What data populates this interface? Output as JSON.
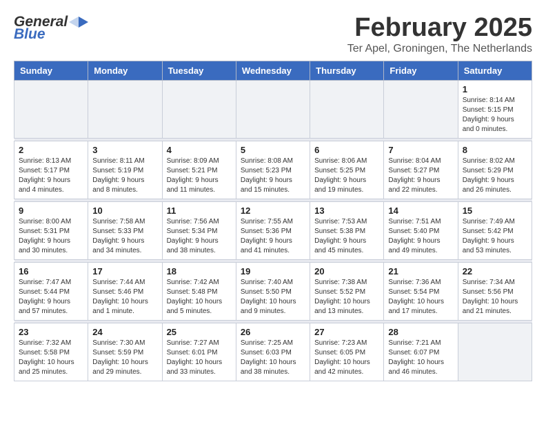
{
  "header": {
    "logo_general": "General",
    "logo_blue": "Blue",
    "month_title": "February 2025",
    "subtitle": "Ter Apel, Groningen, The Netherlands"
  },
  "weekdays": [
    "Sunday",
    "Monday",
    "Tuesday",
    "Wednesday",
    "Thursday",
    "Friday",
    "Saturday"
  ],
  "weeks": [
    [
      {
        "day": "",
        "empty": true
      },
      {
        "day": "",
        "empty": true
      },
      {
        "day": "",
        "empty": true
      },
      {
        "day": "",
        "empty": true
      },
      {
        "day": "",
        "empty": true
      },
      {
        "day": "",
        "empty": true
      },
      {
        "day": "1",
        "info": "Sunrise: 8:14 AM\nSunset: 5:15 PM\nDaylight: 9 hours and 0 minutes."
      }
    ],
    [
      {
        "day": "2",
        "info": "Sunrise: 8:13 AM\nSunset: 5:17 PM\nDaylight: 9 hours and 4 minutes."
      },
      {
        "day": "3",
        "info": "Sunrise: 8:11 AM\nSunset: 5:19 PM\nDaylight: 9 hours and 8 minutes."
      },
      {
        "day": "4",
        "info": "Sunrise: 8:09 AM\nSunset: 5:21 PM\nDaylight: 9 hours and 11 minutes."
      },
      {
        "day": "5",
        "info": "Sunrise: 8:08 AM\nSunset: 5:23 PM\nDaylight: 9 hours and 15 minutes."
      },
      {
        "day": "6",
        "info": "Sunrise: 8:06 AM\nSunset: 5:25 PM\nDaylight: 9 hours and 19 minutes."
      },
      {
        "day": "7",
        "info": "Sunrise: 8:04 AM\nSunset: 5:27 PM\nDaylight: 9 hours and 22 minutes."
      },
      {
        "day": "8",
        "info": "Sunrise: 8:02 AM\nSunset: 5:29 PM\nDaylight: 9 hours and 26 minutes."
      }
    ],
    [
      {
        "day": "9",
        "info": "Sunrise: 8:00 AM\nSunset: 5:31 PM\nDaylight: 9 hours and 30 minutes."
      },
      {
        "day": "10",
        "info": "Sunrise: 7:58 AM\nSunset: 5:33 PM\nDaylight: 9 hours and 34 minutes."
      },
      {
        "day": "11",
        "info": "Sunrise: 7:56 AM\nSunset: 5:34 PM\nDaylight: 9 hours and 38 minutes."
      },
      {
        "day": "12",
        "info": "Sunrise: 7:55 AM\nSunset: 5:36 PM\nDaylight: 9 hours and 41 minutes."
      },
      {
        "day": "13",
        "info": "Sunrise: 7:53 AM\nSunset: 5:38 PM\nDaylight: 9 hours and 45 minutes."
      },
      {
        "day": "14",
        "info": "Sunrise: 7:51 AM\nSunset: 5:40 PM\nDaylight: 9 hours and 49 minutes."
      },
      {
        "day": "15",
        "info": "Sunrise: 7:49 AM\nSunset: 5:42 PM\nDaylight: 9 hours and 53 minutes."
      }
    ],
    [
      {
        "day": "16",
        "info": "Sunrise: 7:47 AM\nSunset: 5:44 PM\nDaylight: 9 hours and 57 minutes."
      },
      {
        "day": "17",
        "info": "Sunrise: 7:44 AM\nSunset: 5:46 PM\nDaylight: 10 hours and 1 minute."
      },
      {
        "day": "18",
        "info": "Sunrise: 7:42 AM\nSunset: 5:48 PM\nDaylight: 10 hours and 5 minutes."
      },
      {
        "day": "19",
        "info": "Sunrise: 7:40 AM\nSunset: 5:50 PM\nDaylight: 10 hours and 9 minutes."
      },
      {
        "day": "20",
        "info": "Sunrise: 7:38 AM\nSunset: 5:52 PM\nDaylight: 10 hours and 13 minutes."
      },
      {
        "day": "21",
        "info": "Sunrise: 7:36 AM\nSunset: 5:54 PM\nDaylight: 10 hours and 17 minutes."
      },
      {
        "day": "22",
        "info": "Sunrise: 7:34 AM\nSunset: 5:56 PM\nDaylight: 10 hours and 21 minutes."
      }
    ],
    [
      {
        "day": "23",
        "info": "Sunrise: 7:32 AM\nSunset: 5:58 PM\nDaylight: 10 hours and 25 minutes."
      },
      {
        "day": "24",
        "info": "Sunrise: 7:30 AM\nSunset: 5:59 PM\nDaylight: 10 hours and 29 minutes."
      },
      {
        "day": "25",
        "info": "Sunrise: 7:27 AM\nSunset: 6:01 PM\nDaylight: 10 hours and 33 minutes."
      },
      {
        "day": "26",
        "info": "Sunrise: 7:25 AM\nSunset: 6:03 PM\nDaylight: 10 hours and 38 minutes."
      },
      {
        "day": "27",
        "info": "Sunrise: 7:23 AM\nSunset: 6:05 PM\nDaylight: 10 hours and 42 minutes."
      },
      {
        "day": "28",
        "info": "Sunrise: 7:21 AM\nSunset: 6:07 PM\nDaylight: 10 hours and 46 minutes."
      },
      {
        "day": "",
        "empty": true
      }
    ]
  ]
}
